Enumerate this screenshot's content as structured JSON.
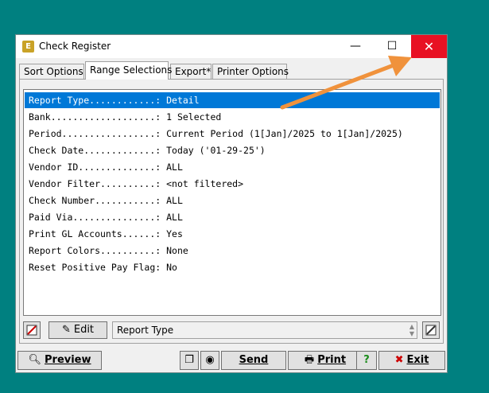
{
  "window": {
    "title": "Check Register",
    "icon_label": "E",
    "minimize_glyph": "—",
    "maximize_glyph": "☐",
    "close_glyph": "✕",
    "close_color": "#e81123"
  },
  "tabs": [
    {
      "label": "Sort Options",
      "active": false
    },
    {
      "label": "Range Selections",
      "active": true
    },
    {
      "label": "Export*",
      "active": false
    },
    {
      "label": "Printer Options",
      "active": false
    }
  ],
  "list": {
    "selected_color": "#0078d7",
    "rows": [
      {
        "label": "Report Type............",
        "value": ": Detail"
      },
      {
        "label": "Bank...................",
        "value": ": 1 Selected"
      },
      {
        "label": "Period.................",
        "value": ": Current Period (1[Jan]/2025 to 1[Jan]/2025)"
      },
      {
        "label": "Check Date.............",
        "value": ": Today ('01-29-25')"
      },
      {
        "label": "Vendor ID..............",
        "value": ": ALL"
      },
      {
        "label": "Vendor Filter..........",
        "value": ": <not filtered>"
      },
      {
        "label": "Check Number...........",
        "value": ": ALL"
      },
      {
        "label": "Paid Via...............",
        "value": ": ALL"
      },
      {
        "label": "Print GL Accounts......",
        "value": ": Yes"
      },
      {
        "label": "Report Colors..........",
        "value": ": None"
      },
      {
        "label": "Reset Positive Pay Flag",
        "value": ": No"
      }
    ]
  },
  "editbar": {
    "edit_label": "Edit",
    "field_value": "Report Type"
  },
  "actions": {
    "preview": "Preview",
    "send": "Send",
    "print": "Print",
    "help": "?",
    "exit": "Exit"
  },
  "annotation_color": "#f0923c"
}
